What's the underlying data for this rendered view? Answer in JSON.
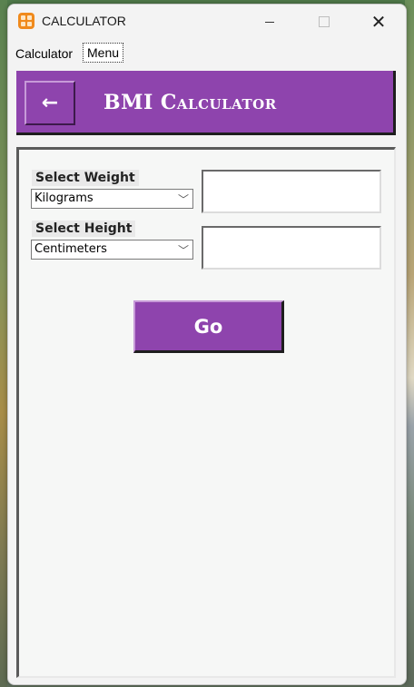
{
  "window": {
    "title": "CALCULATOR",
    "controls": {
      "minimize": "—",
      "maximize": "□",
      "close": "✕"
    }
  },
  "menubar": {
    "items": [
      "Calculator",
      "Menu"
    ]
  },
  "header": {
    "back_label": "←",
    "title": "BMI Calculator"
  },
  "form": {
    "weight": {
      "label": "Select Weight",
      "selected": "Kilograms",
      "value": ""
    },
    "height": {
      "label": "Select Height",
      "selected": "Centimeters",
      "value": ""
    },
    "go_label": "Go"
  },
  "colors": {
    "accent": "#8e44ad",
    "panel": "#f6f7f6"
  },
  "icons": {
    "app": "calculator-app-icon",
    "dropdown": "chevron-down-icon",
    "back": "arrow-left-icon"
  }
}
